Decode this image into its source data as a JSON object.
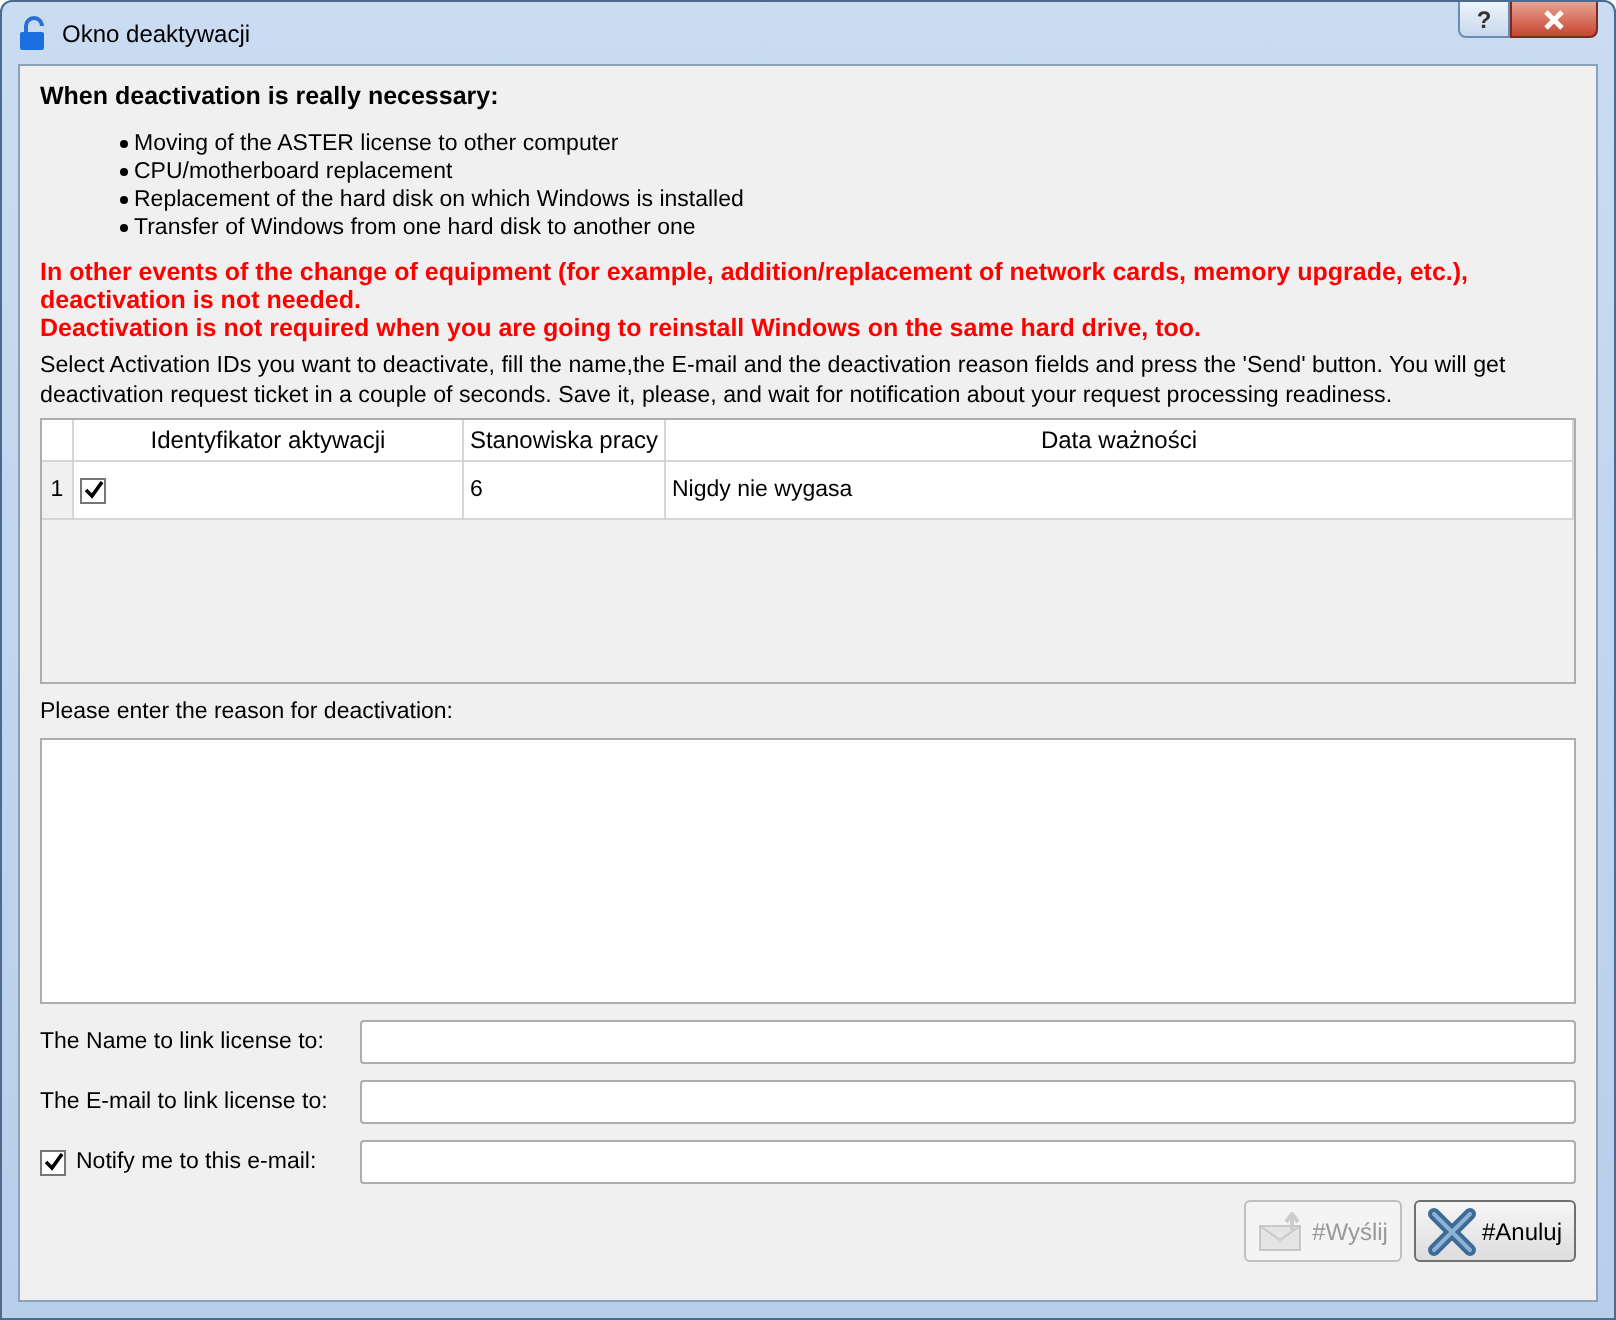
{
  "window": {
    "title": "Okno deaktywacji",
    "help": "?"
  },
  "heading": "When deactivation is really necessary:",
  "cases": [
    "Moving of the ASTER license to other computer",
    "CPU/motherboard replacement",
    "Replacement of the hard disk on which Windows is installed",
    "Transfer of Windows from one hard disk to another one"
  ],
  "warnings": [
    "In other events of the change of equipment (for example, addition/replacement of network cards, memory upgrade, etc.), deactivation is not needed.",
    "Deactivation is not required when you are going to reinstall Windows on the same hard drive, too."
  ],
  "instructions": "Select Activation IDs you want to deactivate, fill the name,the E-mail and the deactivation reason fields and press the 'Send' button. You will get deactivation request ticket in a couple of seconds. Save it, please, and wait for notification about your request processing readiness.",
  "table": {
    "columns": [
      "Identyfikator aktywacji",
      "Stanowiska pracy",
      "Data ważności"
    ],
    "rows": [
      {
        "number": "1",
        "checked": true,
        "workstations": "6",
        "expiry": "Nigdy nie wygasa"
      }
    ]
  },
  "reason": {
    "label": "Please enter the reason for deactivation:"
  },
  "fields": [
    {
      "kind": "text",
      "label": "The Name to link license to:"
    },
    {
      "kind": "text",
      "label": "The E-mail to link license to:"
    },
    {
      "kind": "checkbox",
      "label": "Notify me to this e-mail:",
      "checked": true
    }
  ],
  "buttons": [
    {
      "kind": "send",
      "label": "#Wyślij",
      "disabled": true
    },
    {
      "kind": "cancel",
      "label": "#Anuluj",
      "disabled": false
    }
  ]
}
